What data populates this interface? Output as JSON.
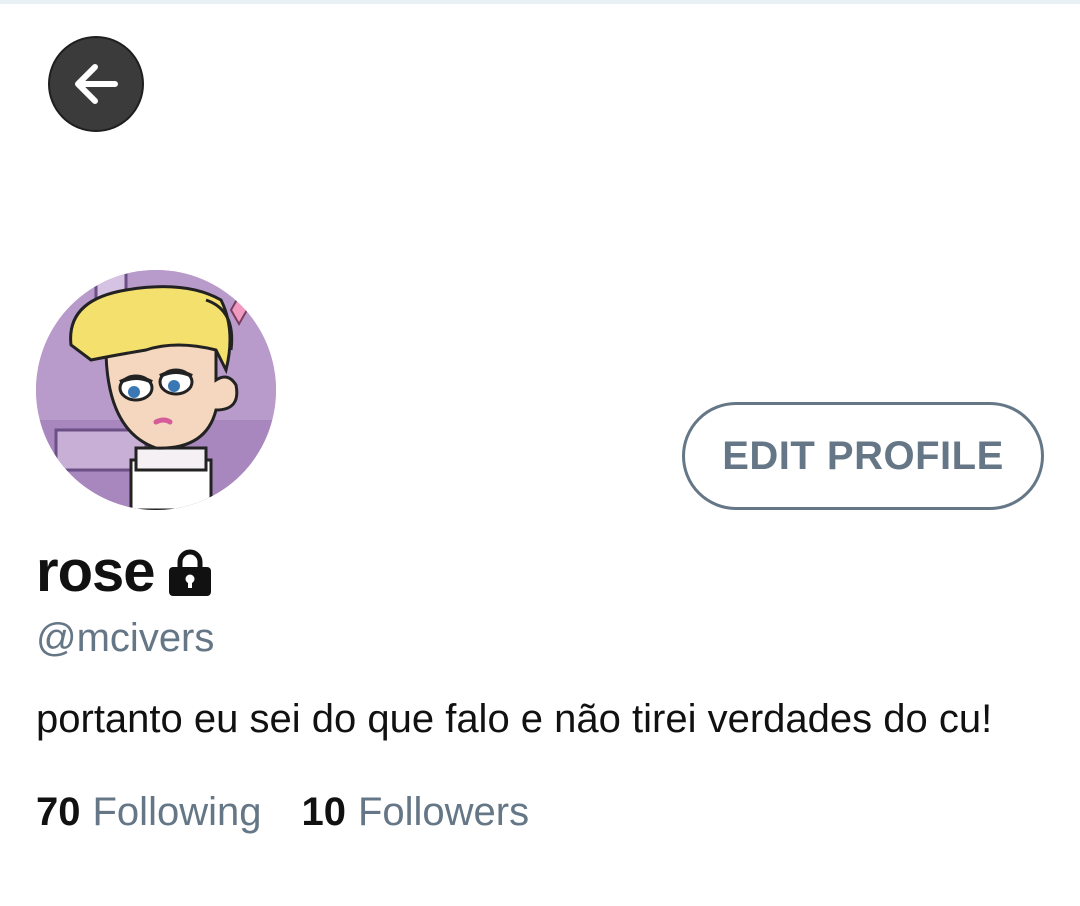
{
  "header": {
    "back_icon": "arrow-left-icon"
  },
  "profile": {
    "display_name": "rose",
    "protected_icon": "lock-icon",
    "handle": "@mcivers",
    "bio": "portanto eu sei do que falo e não tirei verdades do cu!",
    "edit_profile_label": "EDIT PROFILE",
    "stats": {
      "following_count": "70",
      "following_label": "Following",
      "followers_count": "10",
      "followers_label": "Followers"
    }
  },
  "colors": {
    "secondary_text": "#657786",
    "primary_text": "#111111",
    "back_button_bg": "#3b3b3b"
  }
}
